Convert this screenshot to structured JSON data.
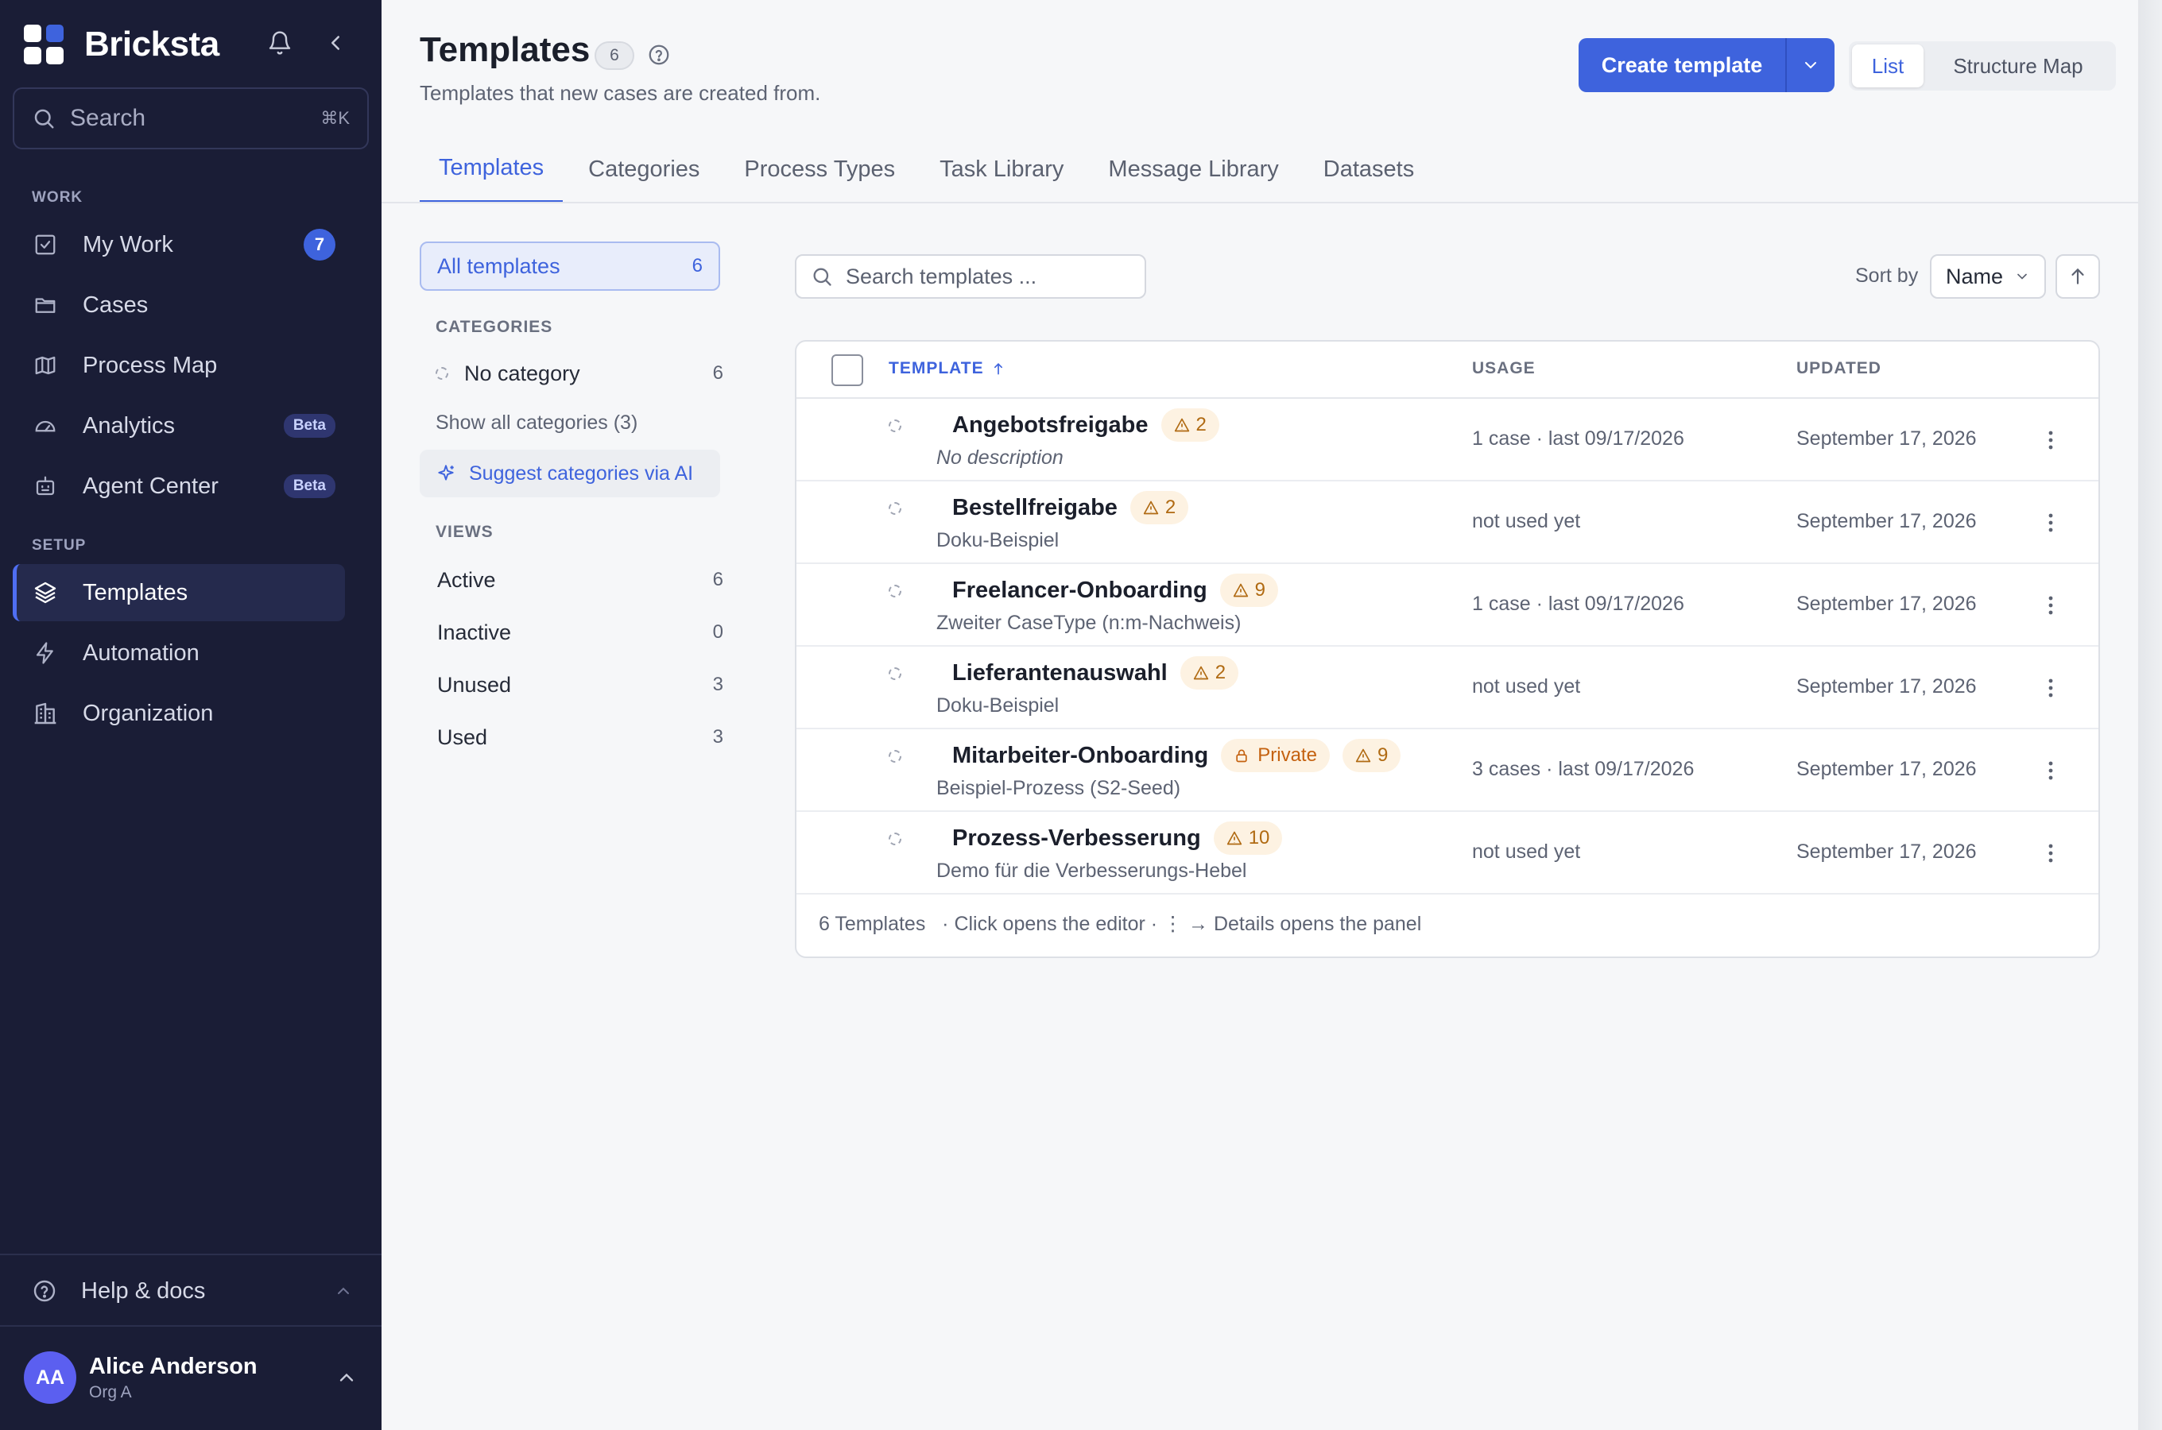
{
  "app": {
    "name": "Bricksta"
  },
  "sidebar": {
    "search": {
      "placeholder": "Search",
      "shortcut": "⌘K"
    },
    "sections": {
      "work": "WORK",
      "setup": "SETUP"
    },
    "items": [
      {
        "label": "My Work",
        "icon": "checkbox-icon",
        "badge": "7"
      },
      {
        "label": "Cases",
        "icon": "folder-icon"
      },
      {
        "label": "Process Map",
        "icon": "map-icon"
      },
      {
        "label": "Analytics",
        "icon": "gauge-icon",
        "badge": "Beta"
      },
      {
        "label": "Agent Center",
        "icon": "bot-icon",
        "badge": "Beta"
      },
      {
        "label": "Templates",
        "icon": "layers-icon",
        "active": true
      },
      {
        "label": "Automation",
        "icon": "bolt-icon"
      },
      {
        "label": "Organization",
        "icon": "building-icon"
      }
    ],
    "help": {
      "label": "Help & docs"
    },
    "user": {
      "initials": "AA",
      "name": "Alice Anderson",
      "org": "Org A"
    }
  },
  "header": {
    "title": "Templates",
    "count": "6",
    "subtitle": "Templates that new cases are created from.",
    "create_label": "Create template",
    "view_options": [
      "List",
      "Structure Map"
    ],
    "active_view": "List"
  },
  "tabs": [
    "Templates",
    "Categories",
    "Process Types",
    "Task Library",
    "Message Library",
    "Datasets"
  ],
  "active_tab": "Templates",
  "filters": {
    "all": {
      "label": "All templates",
      "count": "6"
    },
    "categories_heading": "CATEGORIES",
    "no_category": {
      "label": "No category",
      "count": "6"
    },
    "show_all": "Show all categories (3)",
    "suggest": "Suggest categories via AI",
    "views_heading": "VIEWS",
    "views": [
      {
        "label": "Active",
        "count": "6"
      },
      {
        "label": "Inactive",
        "count": "0"
      },
      {
        "label": "Unused",
        "count": "3"
      },
      {
        "label": "Used",
        "count": "3"
      }
    ]
  },
  "list": {
    "search_placeholder": "Search templates ...",
    "sort_label": "Sort by",
    "sort_value": "Name",
    "columns": {
      "template": "TEMPLATE",
      "usage": "USAGE",
      "updated": "UPDATED"
    },
    "rows": [
      {
        "name": "Angebotsfreigabe",
        "warnings": "2",
        "private": false,
        "description": "No description",
        "description_italic": true,
        "usage": "1 case · last 09/17/2026",
        "updated": "September 17, 2026"
      },
      {
        "name": "Bestellfreigabe",
        "warnings": "2",
        "private": false,
        "description": "Doku-Beispiel",
        "usage": "not used yet",
        "updated": "September 17, 2026"
      },
      {
        "name": "Freelancer-Onboarding",
        "warnings": "9",
        "private": false,
        "description": "Zweiter CaseType (n:m-Nachweis)",
        "usage": "1 case · last 09/17/2026",
        "updated": "September 17, 2026"
      },
      {
        "name": "Lieferantenauswahl",
        "warnings": "2",
        "private": false,
        "description": "Doku-Beispiel",
        "usage": "not used yet",
        "updated": "September 17, 2026"
      },
      {
        "name": "Mitarbeiter-Onboarding",
        "warnings": "9",
        "private": true,
        "private_label": "Private",
        "description": "Beispiel-Prozess (S2-Seed)",
        "usage": "3 cases · last 09/17/2026",
        "updated": "September 17, 2026"
      },
      {
        "name": "Prozess-Verbesserung",
        "warnings": "10",
        "private": false,
        "description": "Demo für die Verbesserungs-Hebel",
        "usage": "not used yet",
        "updated": "September 17, 2026"
      }
    ],
    "footer": "6 Templates   · Click opens the editor · ⋮ → Details opens the panel"
  },
  "colors": {
    "accent": "#3e63dd",
    "sidebar_bg": "#1a1d36",
    "warning_bg": "#fdf2e2",
    "warning_fg": "#b06a12"
  }
}
